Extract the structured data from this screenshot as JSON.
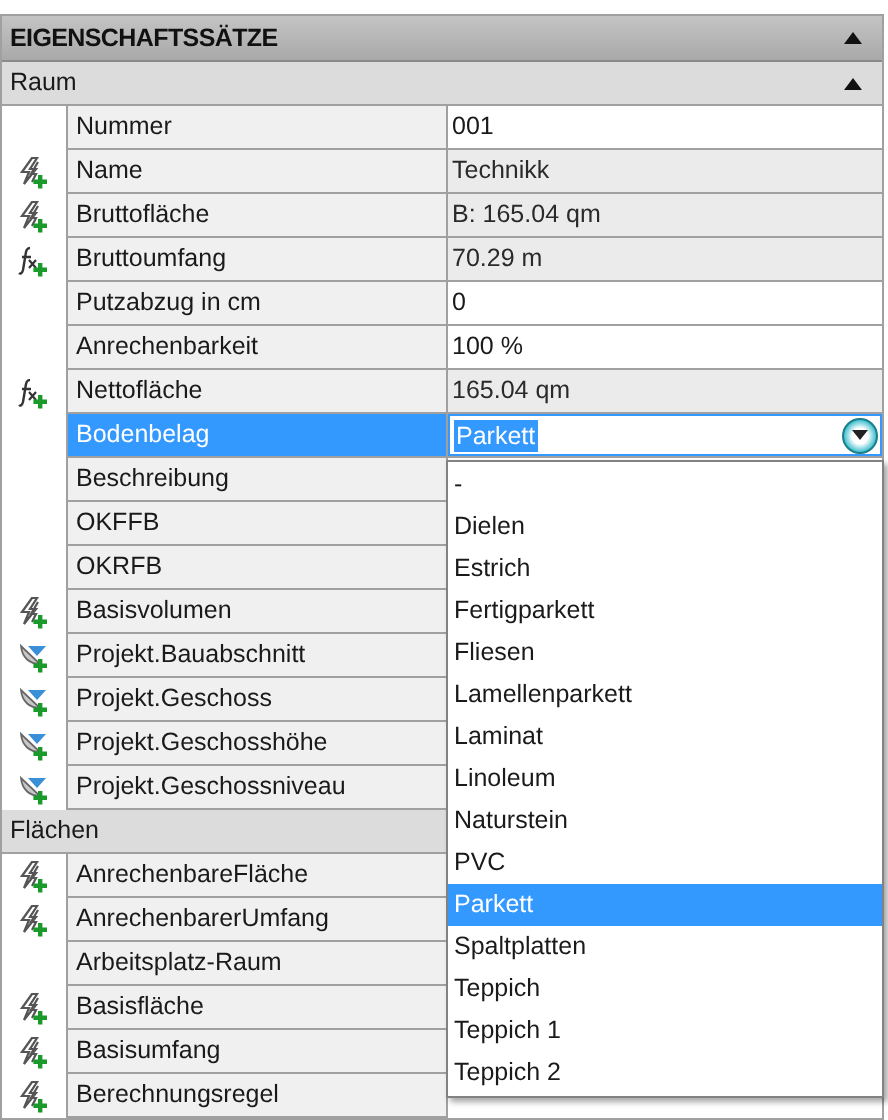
{
  "panel": {
    "title": "EIGENSCHAFTSSÄTZE",
    "expanded": true
  },
  "sections": [
    {
      "title": "Raum",
      "expanded": true,
      "rows": [
        {
          "name": "Nummer",
          "value": "001",
          "editable": true,
          "selected": false
        },
        {
          "name": "Name",
          "value": "Technikk",
          "editable": false,
          "icon": {
            "kind": "bolt"
          },
          "selected": false
        },
        {
          "name": "Bruttofläche",
          "value": "B: 165.04 qm",
          "editable": false,
          "icon": {
            "kind": "bolt"
          },
          "selected": false
        },
        {
          "name": "Bruttoumfang",
          "value": "70.29 m",
          "editable": false,
          "icon": {
            "kind": "formula"
          },
          "selected": false
        },
        {
          "name": "Putzabzug in cm",
          "value": "0",
          "editable": true,
          "selected": false
        },
        {
          "name": "Anrechenbarkeit",
          "value": "100 %",
          "editable": true,
          "selected": false
        },
        {
          "name": "Nettofläche",
          "value": "165.04 qm",
          "editable": false,
          "icon": {
            "kind": "formula"
          },
          "selected": false
        },
        {
          "name": "Bodenbelag",
          "value": "Parkett",
          "selected": true,
          "kind": "dropdown",
          "open": true,
          "options": [
            {
              "label": "-",
              "selected": false
            },
            {
              "label": "Dielen",
              "selected": false
            },
            {
              "label": "Estrich",
              "selected": false
            },
            {
              "label": "Fertigparkett",
              "selected": false
            },
            {
              "label": "Fliesen",
              "selected": false
            },
            {
              "label": "Lamellenparkett",
              "selected": false
            },
            {
              "label": "Laminat",
              "selected": false
            },
            {
              "label": "Linoleum",
              "selected": false
            },
            {
              "label": "Naturstein",
              "selected": false
            },
            {
              "label": "PVC",
              "selected": false
            },
            {
              "label": "Parkett",
              "selected": true
            },
            {
              "label": "Spaltplatten",
              "selected": false
            },
            {
              "label": "Teppich",
              "selected": false
            },
            {
              "label": "Teppich 1",
              "selected": false
            },
            {
              "label": "Teppich 2",
              "selected": false
            }
          ]
        },
        {
          "name": "Beschreibung",
          "selected": false
        },
        {
          "name": "OKFFB",
          "selected": false
        },
        {
          "name": "OKRFB",
          "selected": false
        },
        {
          "name": "Basisvolumen",
          "icon": {
            "kind": "bolt"
          },
          "selected": false
        },
        {
          "name": "Projekt.Bauabschnitt",
          "icon": {
            "kind": "project"
          },
          "selected": false
        },
        {
          "name": "Projekt.Geschoss",
          "icon": {
            "kind": "project"
          },
          "selected": false
        },
        {
          "name": "Projekt.Geschosshöhe",
          "icon": {
            "kind": "project"
          },
          "selected": false
        },
        {
          "name": "Projekt.Geschossniveau",
          "icon": {
            "kind": "project"
          },
          "selected": false
        }
      ]
    },
    {
      "title": "Flächen",
      "rows": [
        {
          "name": "AnrechenbareFläche",
          "icon": {
            "kind": "bolt"
          },
          "selected": false
        },
        {
          "name": "AnrechenbarerUmfang",
          "icon": {
            "kind": "bolt"
          },
          "selected": false
        },
        {
          "name": "Arbeitsplatz-Raum",
          "selected": false
        },
        {
          "name": "Basisfläche",
          "icon": {
            "kind": "bolt"
          },
          "selected": false
        },
        {
          "name": "Basisumfang",
          "icon": {
            "kind": "bolt"
          },
          "selected": false
        },
        {
          "name": "Berechnungsregel",
          "icon": {
            "kind": "bolt"
          },
          "selected": false
        }
      ]
    }
  ]
}
